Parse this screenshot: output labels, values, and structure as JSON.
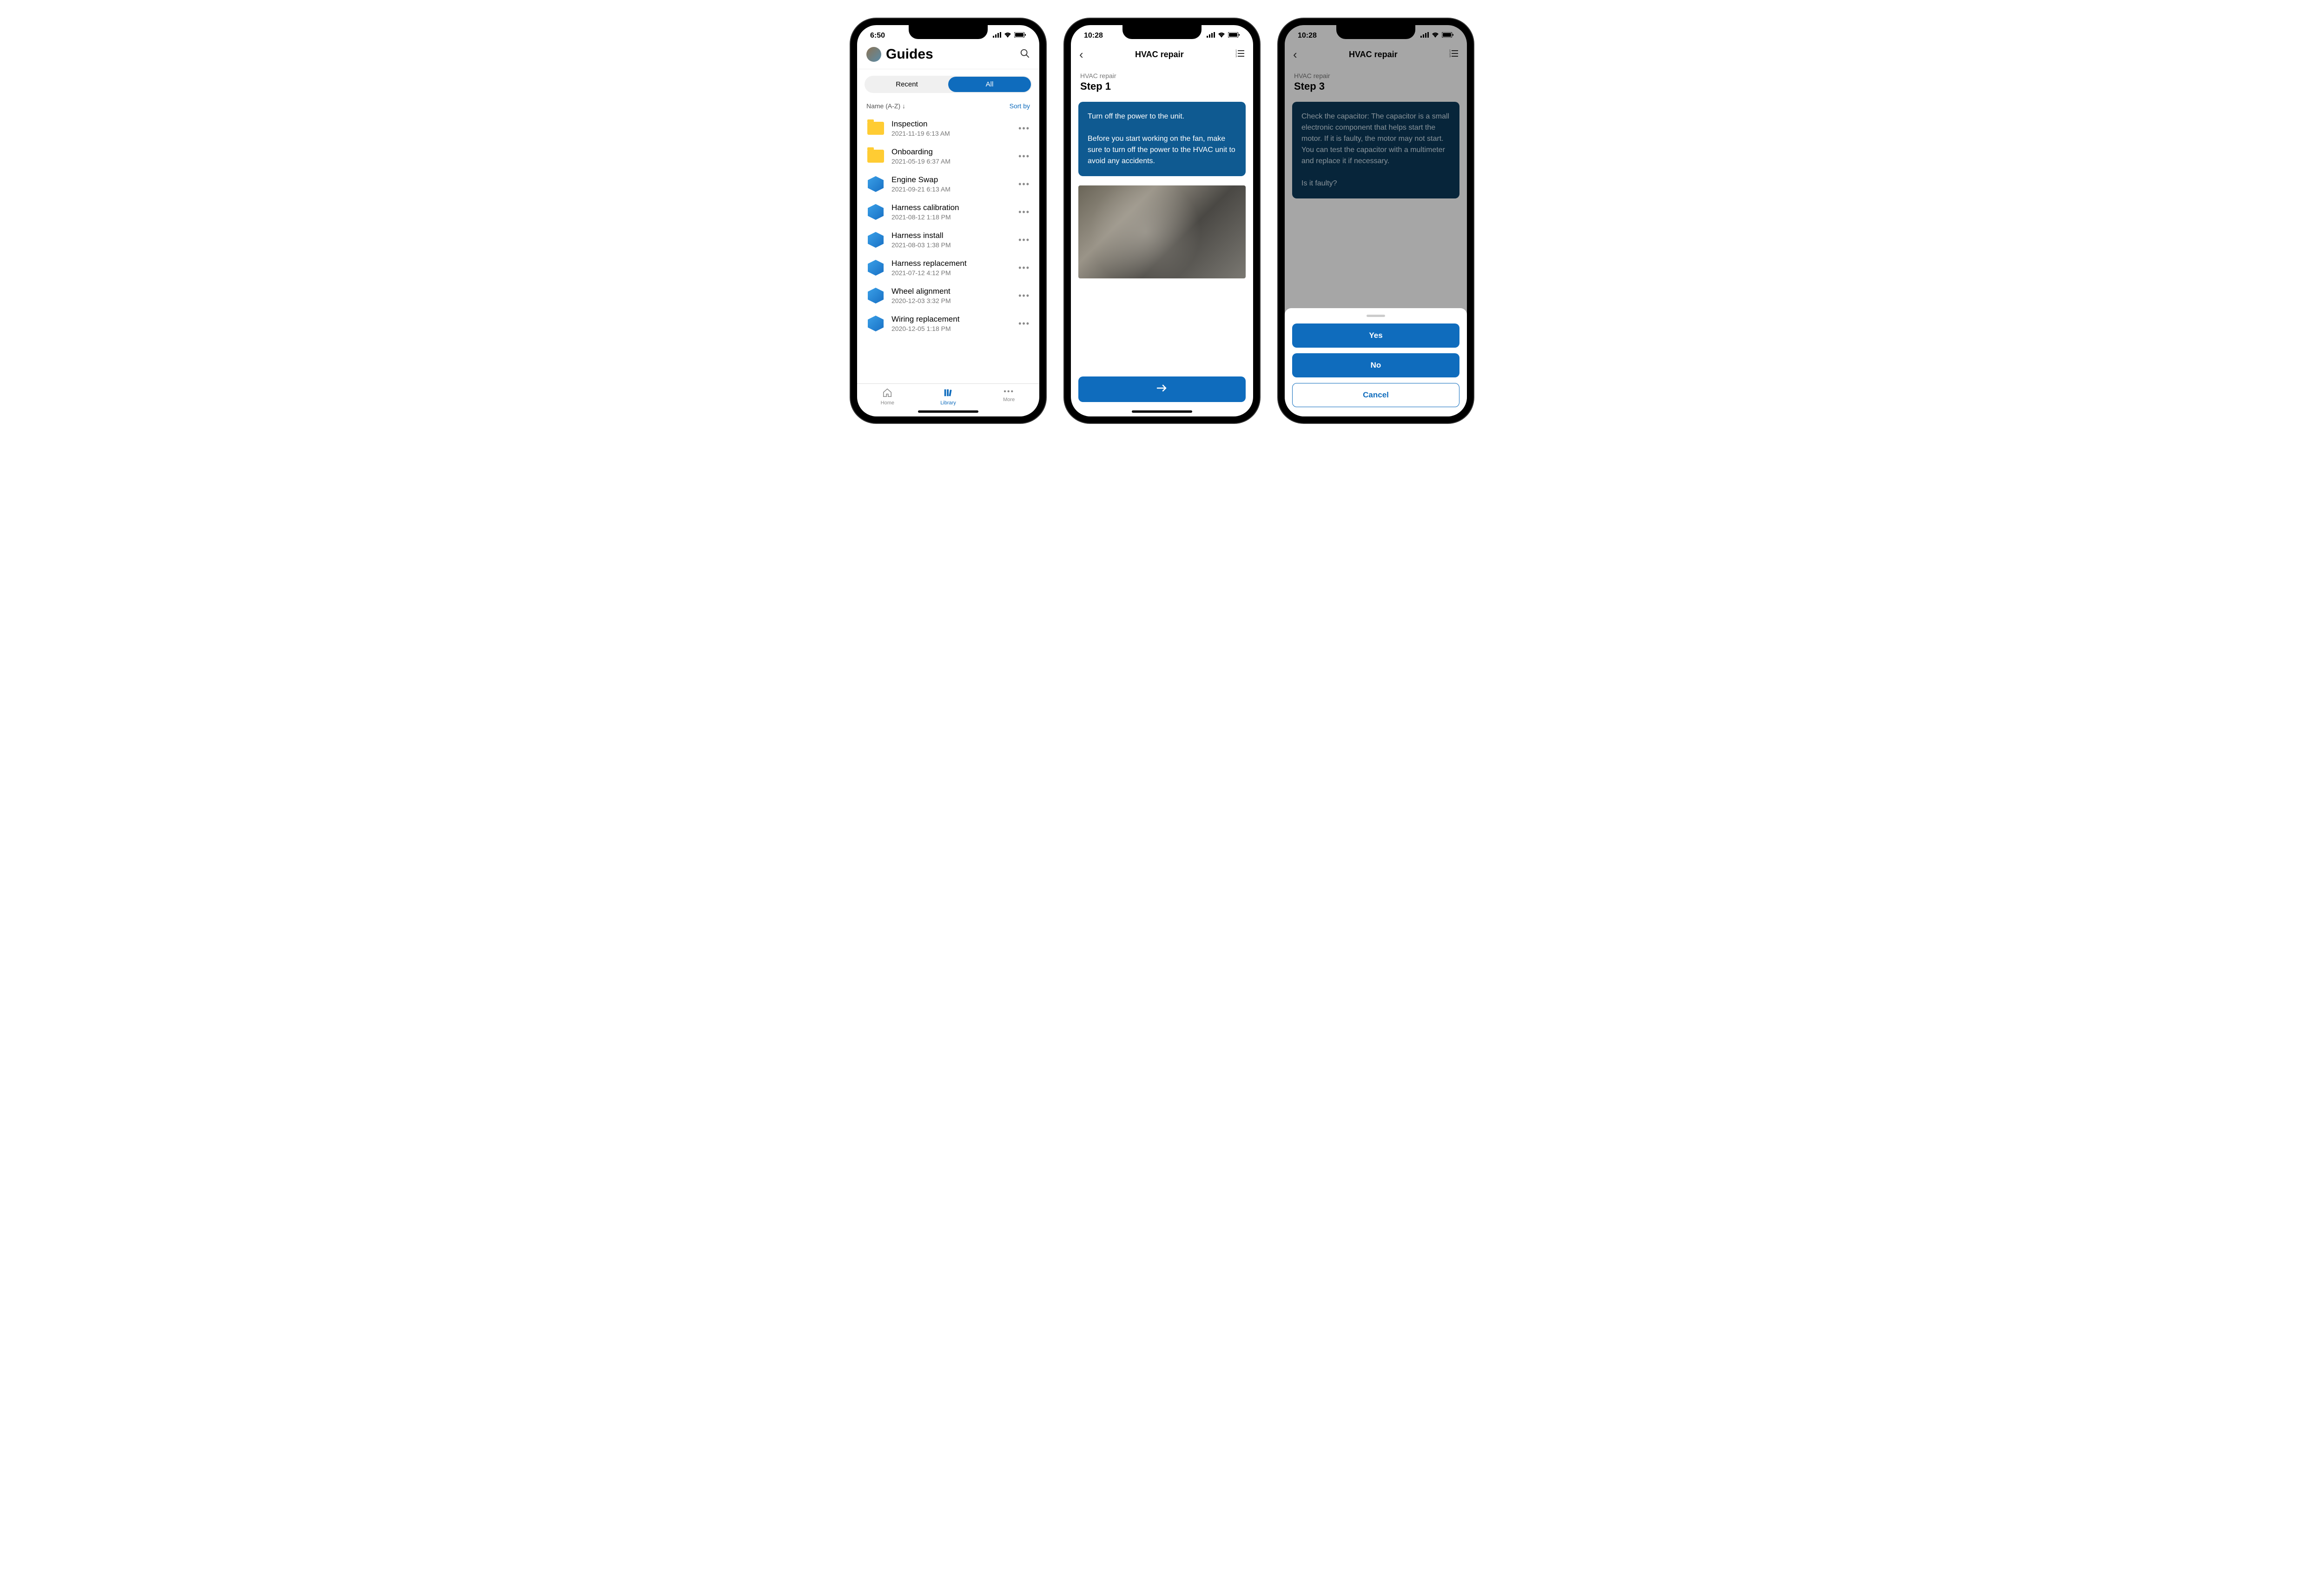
{
  "screen1": {
    "time": "6:50",
    "title": "Guides",
    "tabs": {
      "recent": "Recent",
      "all": "All"
    },
    "sort_label": "Name (A-Z)  ↓",
    "sort_by": "Sort by",
    "items": [
      {
        "type": "folder",
        "title": "Inspection",
        "date": "2021-11-19 6:13 AM"
      },
      {
        "type": "folder",
        "title": "Onboarding",
        "date": "2021-05-19 6:37 AM"
      },
      {
        "type": "guide",
        "title": "Engine Swap",
        "date": "2021-09-21 6:13 AM"
      },
      {
        "type": "guide",
        "title": "Harness calibration",
        "date": "2021-08-12 1:18 PM"
      },
      {
        "type": "guide",
        "title": "Harness install",
        "date": "2021-08-03 1:38 PM"
      },
      {
        "type": "guide",
        "title": "Harness replacement",
        "date": "2021-07-12 4:12 PM"
      },
      {
        "type": "guide",
        "title": "Wheel alignment",
        "date": "2020-12-03 3:32 PM"
      },
      {
        "type": "guide",
        "title": "Wiring replacement",
        "date": "2020-12-05 1:18 PM"
      }
    ],
    "nav": {
      "home": "Home",
      "library": "Library",
      "more": "More"
    }
  },
  "screen2": {
    "time": "10:28",
    "header": "HVAC repair",
    "subtitle": "HVAC repair",
    "step": "Step 1",
    "card_text": "Turn off the power to the unit.\n\nBefore you start working on the fan, make sure to turn off the power to the HVAC unit to avoid any accidents."
  },
  "screen3": {
    "time": "10:28",
    "header": "HVAC repair",
    "subtitle": "HVAC repair",
    "step": "Step 3",
    "card_text": "Check the capacitor: The capacitor is a small electronic component that helps start the motor. If it is faulty, the motor may not start. You can test the capacitor with a multimeter and replace it if necessary.\n\nIs it faulty?",
    "sheet": {
      "yes": "Yes",
      "no": "No",
      "cancel": "Cancel"
    }
  }
}
